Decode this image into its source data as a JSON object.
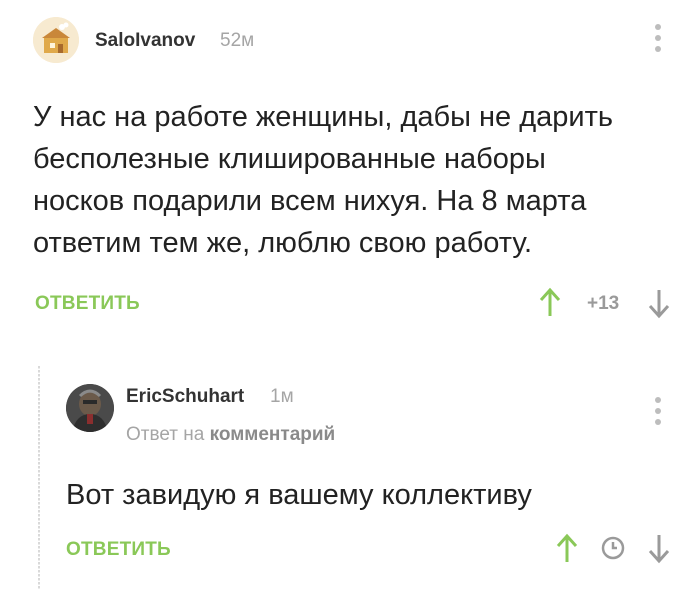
{
  "comments": [
    {
      "username": "SaloIvanov",
      "time": "52м",
      "text": "У нас на работе женщины, дабы не дарить\nбесполезные клишированные наборы\nносков подарили всем нихуя. На 8 марта\nответим тем же, люблю свою работу.",
      "reply_label": "ОТВЕТИТЬ",
      "rating": "+13",
      "colors": {
        "upvote": "#8ac858",
        "downvote": "#9a9a9a",
        "accent": "#8ac858"
      }
    },
    {
      "username": "EricSchuhart",
      "time": "1м",
      "reply_to_prefix": "Ответ на",
      "reply_to_target": "комментарий",
      "text": "Вот завидую я вашему коллективу",
      "reply_label": "ОТВЕТИТЬ"
    }
  ]
}
